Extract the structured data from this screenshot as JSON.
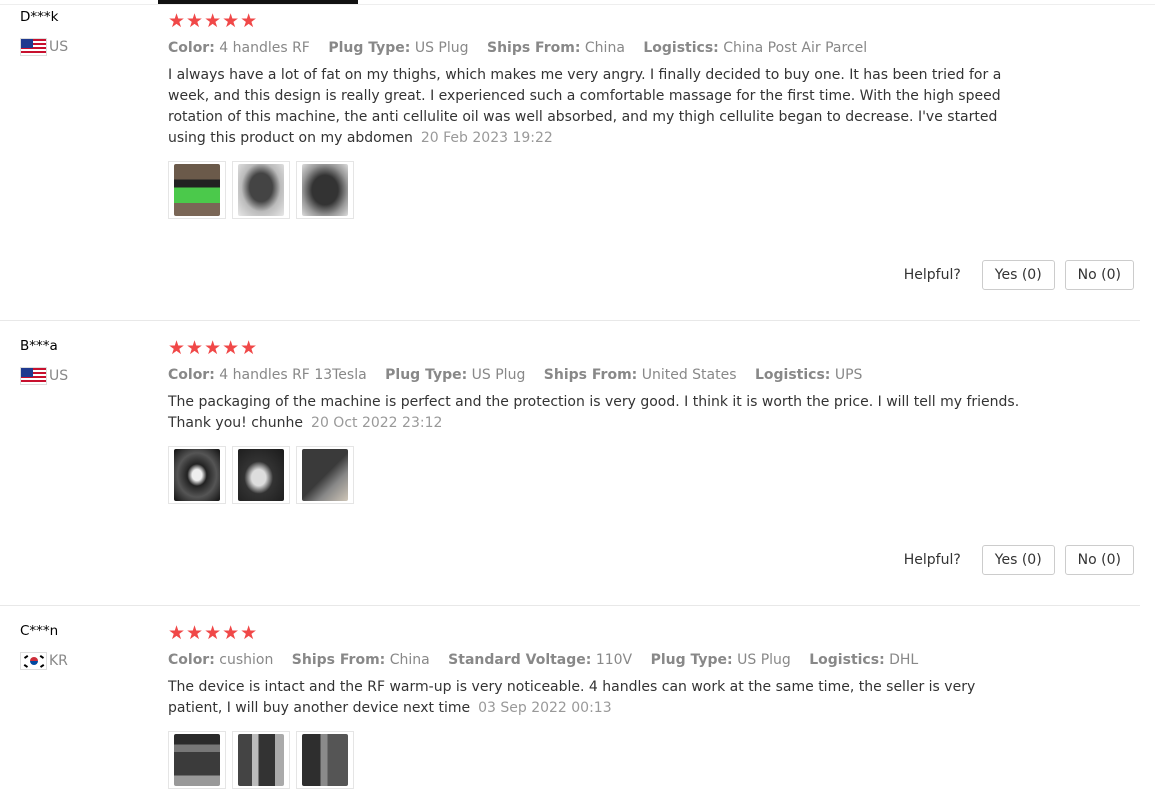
{
  "reviews": [
    {
      "user": "D***k",
      "country": "US",
      "stars": "★★★★★",
      "attributes": [
        {
          "label": "Color:",
          "value": "4 handles RF"
        },
        {
          "label": "Plug Type:",
          "value": "US Plug"
        },
        {
          "label": "Ships From:",
          "value": "China"
        },
        {
          "label": "Logistics:",
          "value": "China Post Air Parcel"
        }
      ],
      "text": "I always have a lot of fat on my thighs, which makes me very angry. I finally decided to buy one. It has been tried for a week, and this design is really great. I experienced such a comfortable massage for the first time. With the high speed rotation of this machine, the anti cellulite oil was well absorbed, and my thigh cellulite began to decrease. I've started using this product on my abdomen",
      "date": "20 Feb 2023 19:22",
      "helpful_label": "Helpful?",
      "yes_label": "Yes (0)",
      "no_label": "No (0)"
    },
    {
      "user": "B***a",
      "country": "US",
      "stars": "★★★★★",
      "attributes": [
        {
          "label": "Color:",
          "value": "4 handles RF 13Tesla"
        },
        {
          "label": "Plug Type:",
          "value": "US Plug"
        },
        {
          "label": "Ships From:",
          "value": "United States"
        },
        {
          "label": "Logistics:",
          "value": "UPS"
        }
      ],
      "text": "The packaging of the machine is perfect and the protection is very good. I think it is worth the price. I will tell my friends. Thank you! chunhe",
      "date": "20 Oct 2022 23:12",
      "helpful_label": "Helpful?",
      "yes_label": "Yes (0)",
      "no_label": "No (0)"
    },
    {
      "user": "C***n",
      "country": "KR",
      "stars": "★★★★★",
      "attributes": [
        {
          "label": "Color:",
          "value": "cushion"
        },
        {
          "label": "Ships From:",
          "value": "China"
        },
        {
          "label": "Standard Voltage:",
          "value": "110V"
        },
        {
          "label": "Plug Type:",
          "value": "US Plug"
        },
        {
          "label": "Logistics:",
          "value": "DHL"
        }
      ],
      "text": "The device is intact and the RF warm-up is very noticeable. 4 handles can work at the same time, the seller is very patient, I will buy another device next time",
      "date": "03 Sep 2022 00:13"
    }
  ],
  "colors": {
    "star": "#f04848",
    "muted": "#888888",
    "date": "#999999",
    "divider": "#e8e8e8"
  }
}
